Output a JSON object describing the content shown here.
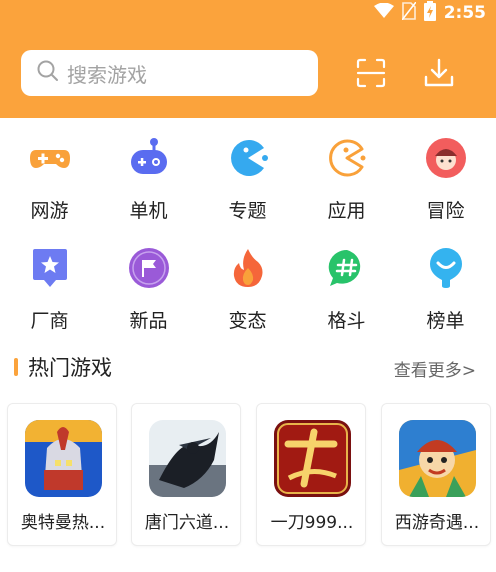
{
  "status_bar": {
    "time": "2:55"
  },
  "search": {
    "placeholder": "搜索游戏"
  },
  "categories": [
    {
      "label": "网游",
      "icon": "gamepad-icon",
      "color": "#f9a13a"
    },
    {
      "label": "单机",
      "icon": "joystick-icon",
      "color": "#5a6cf0"
    },
    {
      "label": "专题",
      "icon": "pacman-icon",
      "color": "#35a9ef"
    },
    {
      "label": "应用",
      "icon": "pacman-outline-icon",
      "color": "#f9a13a"
    },
    {
      "label": "冒险",
      "icon": "adventurer-icon",
      "color": "#f25d5d"
    },
    {
      "label": "厂商",
      "icon": "badge-star-icon",
      "color": "#6d7bf2"
    },
    {
      "label": "新品",
      "icon": "flag-icon",
      "color": "#9a5ad8"
    },
    {
      "label": "变态",
      "icon": "flame-icon",
      "color": "#f5663a"
    },
    {
      "label": "格斗",
      "icon": "hashtag-chat-icon",
      "color": "#28c36a"
    },
    {
      "label": "榜单",
      "icon": "location-pin-icon",
      "color": "#34b3ef"
    }
  ],
  "hot_games": {
    "title": "热门游戏",
    "more": "查看更多>",
    "items": [
      {
        "name": "奥特曼热...",
        "thumb": "ultraman-game-icon"
      },
      {
        "name": "唐门六道...",
        "thumb": "tangmen-game-icon"
      },
      {
        "name": "一刀999...",
        "thumb": "yidao-game-icon"
      },
      {
        "name": "西游奇遇...",
        "thumb": "xiyou-game-icon"
      }
    ]
  }
}
